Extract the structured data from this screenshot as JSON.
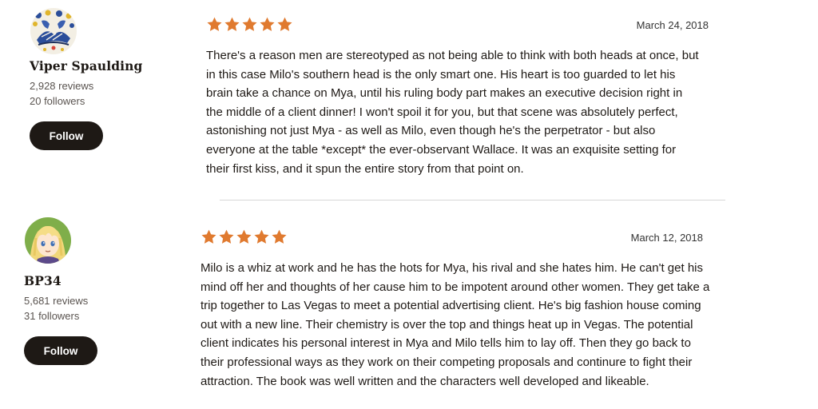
{
  "colors": {
    "star": "#e07a2f",
    "button_bg": "#1e1915",
    "button_text": "#ffffff",
    "divider": "#d8d8d8"
  },
  "reviews": [
    {
      "reviewer": {
        "name": "Viper Spaulding",
        "reviews": "2,928 reviews",
        "followers": "20 followers",
        "follow_label": "Follow",
        "avatar_icon": "folk-art-birds-avatar"
      },
      "rating": 5,
      "date": "March 24, 2018",
      "text": "There's a reason men are stereotyped as not being able to think with both heads at once, but in this case Milo's southern head is the only smart one. His heart is too guarded to let his brain take a chance on Mya, until his ruling body part makes an executive decision right in the middle of a client dinner! I won't spoil it for you, but that scene was absolutely perfect, astonishing not just Mya - as well as Milo, even though he's the perpetrator - but also everyone at the table *except* the ever-observant Wallace. It was an exquisite setting for their first kiss, and it spun the entire story from that point on."
    },
    {
      "reviewer": {
        "name": "BP34",
        "reviews": "5,681 reviews",
        "followers": "31 followers",
        "follow_label": "Follow",
        "avatar_icon": "anime-blonde-character-avatar"
      },
      "rating": 5,
      "date": "March 12, 2018",
      "text": "Milo is a whiz at work and he has the hots for Mya, his rival and she hates him. He can't get his mind off her and thoughts of her cause him to be impotent around other women. They get take a trip together to Las Vegas to meet a potential advertising client. He's big fashion house coming out with a new line. Their chemistry is over the top and things heat up in Vegas. The potential client indicates his personal interest in Mya and Milo tells him to lay off. Then they go back to their professional ways as they work on their competing proposals and continure to fight their attraction. The book was well written and the characters well developed and likeable."
    }
  ]
}
